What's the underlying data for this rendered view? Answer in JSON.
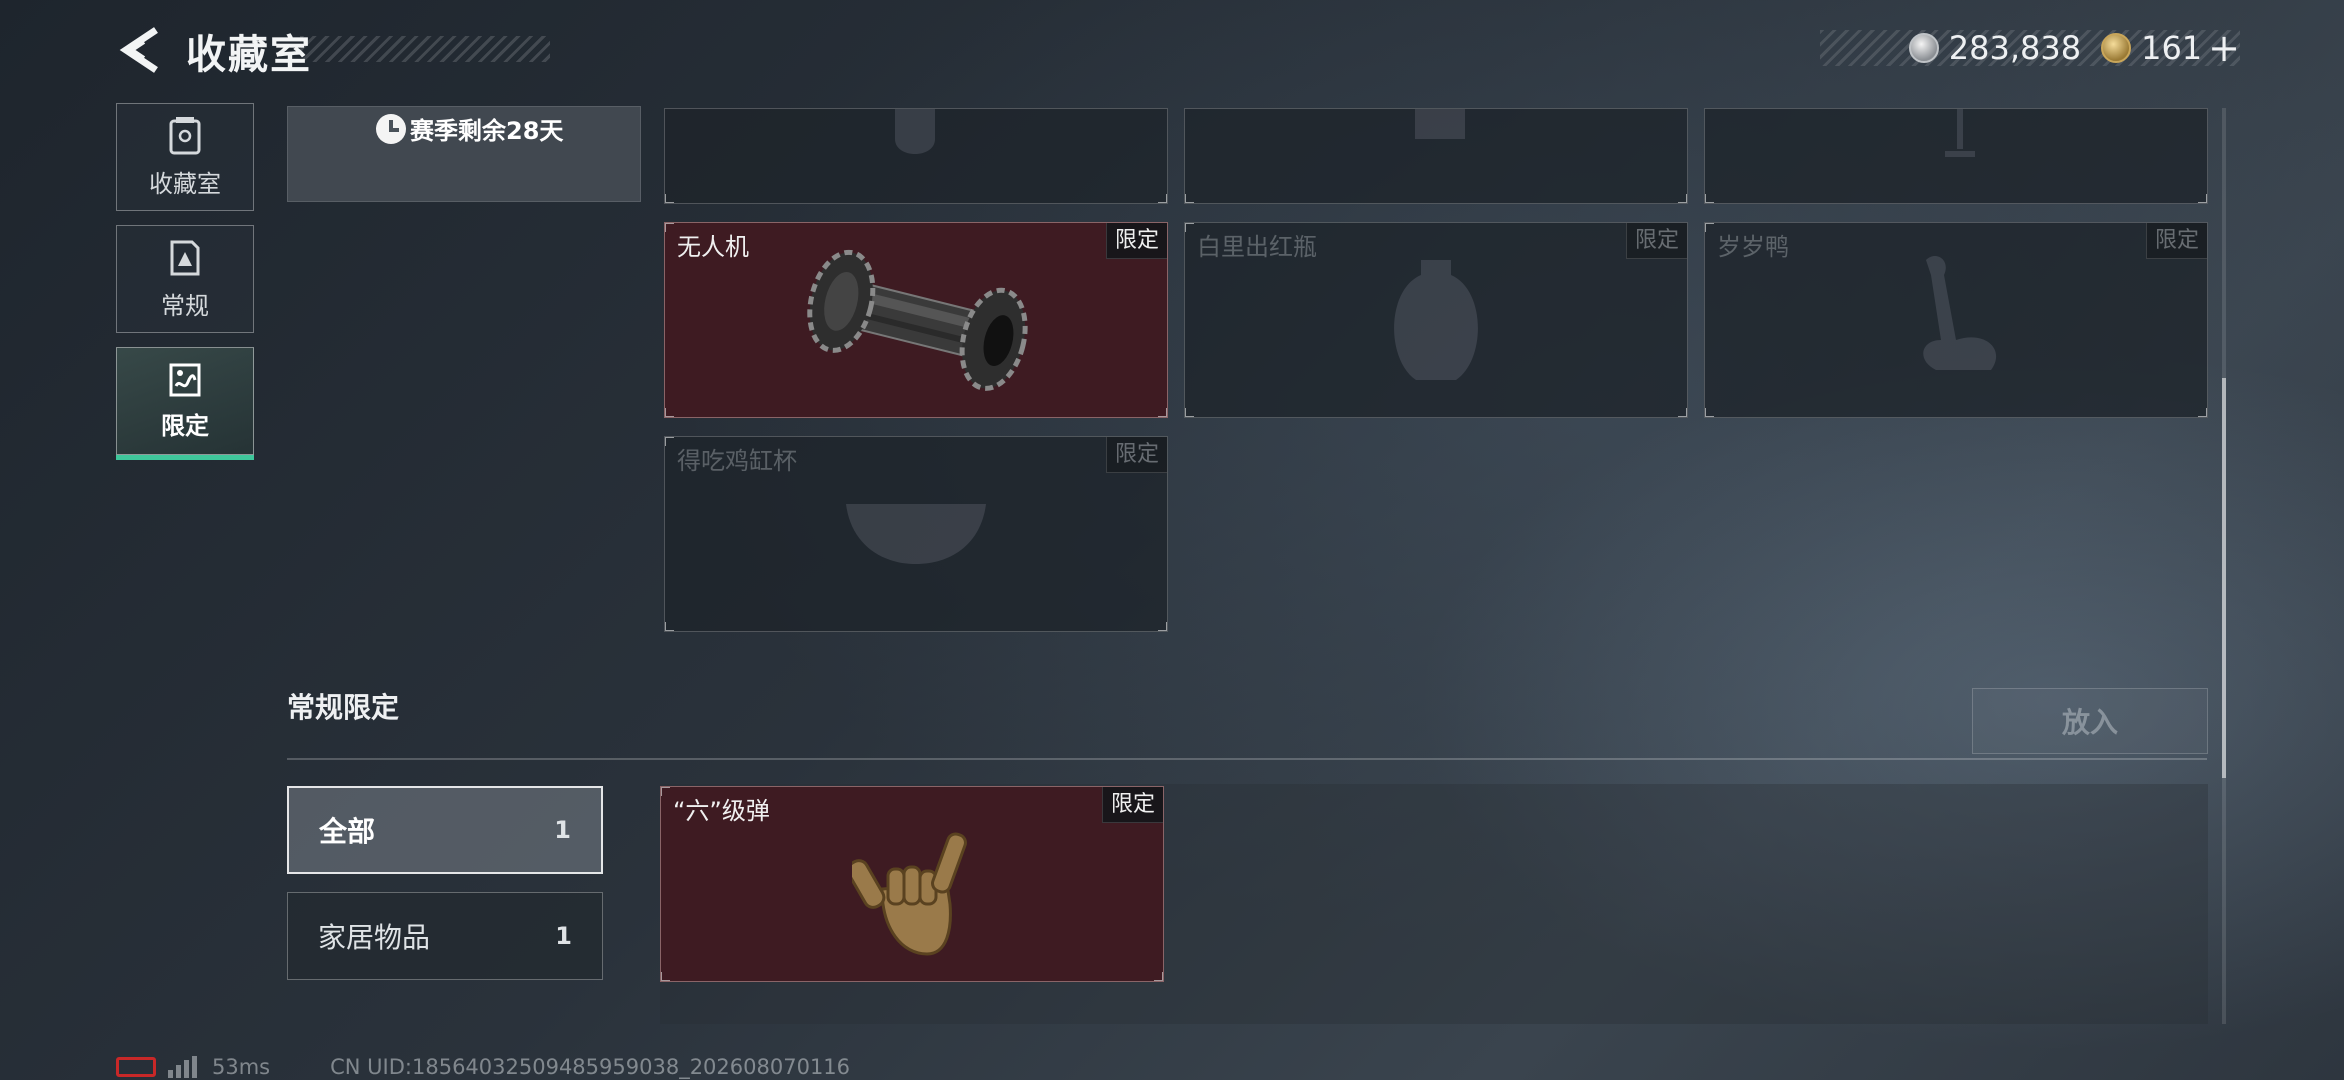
{
  "header": {
    "title": "收藏室",
    "currency": [
      {
        "icon": "silver-coin-icon",
        "value": "283,838"
      },
      {
        "icon": "gold-coin-icon",
        "value": "161"
      }
    ],
    "plus": "+"
  },
  "nav": {
    "items": [
      {
        "label": "收藏室",
        "icon": "collection-room-icon"
      },
      {
        "label": "常规",
        "icon": "regular-icon"
      },
      {
        "label": "限定",
        "icon": "limited-icon",
        "active": true
      }
    ]
  },
  "season": {
    "remaining": "赛季剩余28天"
  },
  "limited_items": [
    {
      "name": "无人机",
      "tag": "限定",
      "owned": true
    },
    {
      "name": "白里出红瓶",
      "tag": "限定",
      "owned": false
    },
    {
      "name": "岁岁鸭",
      "tag": "限定",
      "owned": false
    },
    {
      "name": "得吃鸡缸杯",
      "tag": "限定",
      "owned": false
    }
  ],
  "regular_limited": {
    "title": "常规限定",
    "put_button": "放入",
    "filters": [
      {
        "label": "全部",
        "count": "1",
        "active": true
      },
      {
        "label": "家居物品",
        "count": "1",
        "active": false
      }
    ],
    "items": [
      {
        "name": "“六”级弹",
        "tag": "限定",
        "owned": true
      }
    ]
  },
  "footer": {
    "ping": "53ms",
    "uid": "CN UID:18564032509485959038_202608070116"
  },
  "colors": {
    "accent": "#3fc79b",
    "owned_card": "#3e1b22",
    "battery_warning": "#c82828"
  }
}
